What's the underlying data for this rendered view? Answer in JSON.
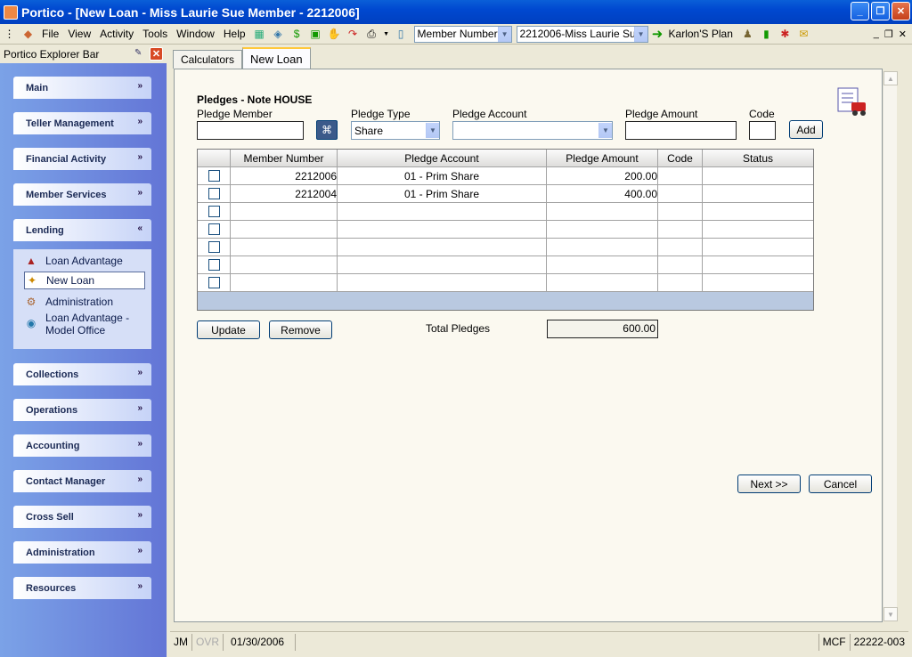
{
  "window": {
    "title": "Portico - [New Loan - Miss Laurie Sue Member - 2212006]"
  },
  "menu": [
    {
      "label": "File"
    },
    {
      "label": "View"
    },
    {
      "label": "Activity"
    },
    {
      "label": "Tools"
    },
    {
      "label": "Window"
    },
    {
      "label": "Help"
    }
  ],
  "toolbar": {
    "lookup_type": "Member Number",
    "member_value": "2212006-Miss Laurie Sue",
    "plan_label": "Karlon'S Plan"
  },
  "explorer": {
    "title": "Portico Explorer Bar",
    "groups": [
      {
        "label": "Main"
      },
      {
        "label": "Teller Management"
      },
      {
        "label": "Financial Activity"
      },
      {
        "label": "Member Services"
      },
      {
        "label": "Lending"
      },
      {
        "label": "Collections"
      },
      {
        "label": "Operations"
      },
      {
        "label": "Accounting"
      },
      {
        "label": "Contact Manager"
      },
      {
        "label": "Cross Sell"
      },
      {
        "label": "Administration"
      },
      {
        "label": "Resources"
      }
    ],
    "lending_items": [
      {
        "label": "Loan Advantage"
      },
      {
        "label": "New Loan"
      },
      {
        "label": "Administration"
      },
      {
        "label": "Loan Advantage -"
      },
      {
        "label": "Model Office"
      }
    ]
  },
  "tabs": [
    {
      "label": "Calculators"
    },
    {
      "label": "New Loan"
    }
  ],
  "form": {
    "heading": "Pledges - Note HOUSE",
    "pledge_member_label": "Pledge Member",
    "pledge_type_label": "Pledge Type",
    "pledge_type_value": "Share",
    "pledge_account_label": "Pledge Account",
    "pledge_amount_label": "Pledge Amount",
    "code_label": "Code",
    "add_label": "Add",
    "update_label": "Update",
    "remove_label": "Remove",
    "total_label": "Total Pledges",
    "total_value": "600.00",
    "next_label": "Next >>",
    "cancel_label": "Cancel"
  },
  "table": {
    "columns": [
      "Member Number",
      "Pledge Account",
      "Pledge Amount",
      "Code",
      "Status"
    ],
    "rows": [
      [
        "2212006",
        "01 - Prim Share",
        "200.00",
        "",
        ""
      ],
      [
        "2212004",
        "01 - Prim Share",
        "400.00",
        "",
        ""
      ],
      [
        "",
        "",
        "",
        "",
        ""
      ],
      [
        "",
        "",
        "",
        "",
        ""
      ],
      [
        "",
        "",
        "",
        "",
        ""
      ],
      [
        "",
        "",
        "",
        "",
        ""
      ],
      [
        "",
        "",
        "",
        "",
        ""
      ]
    ]
  },
  "status": {
    "user": "JM",
    "ovr": "OVR",
    "date": "01/30/2006",
    "mcf": "MCF",
    "code": "22222-003"
  }
}
